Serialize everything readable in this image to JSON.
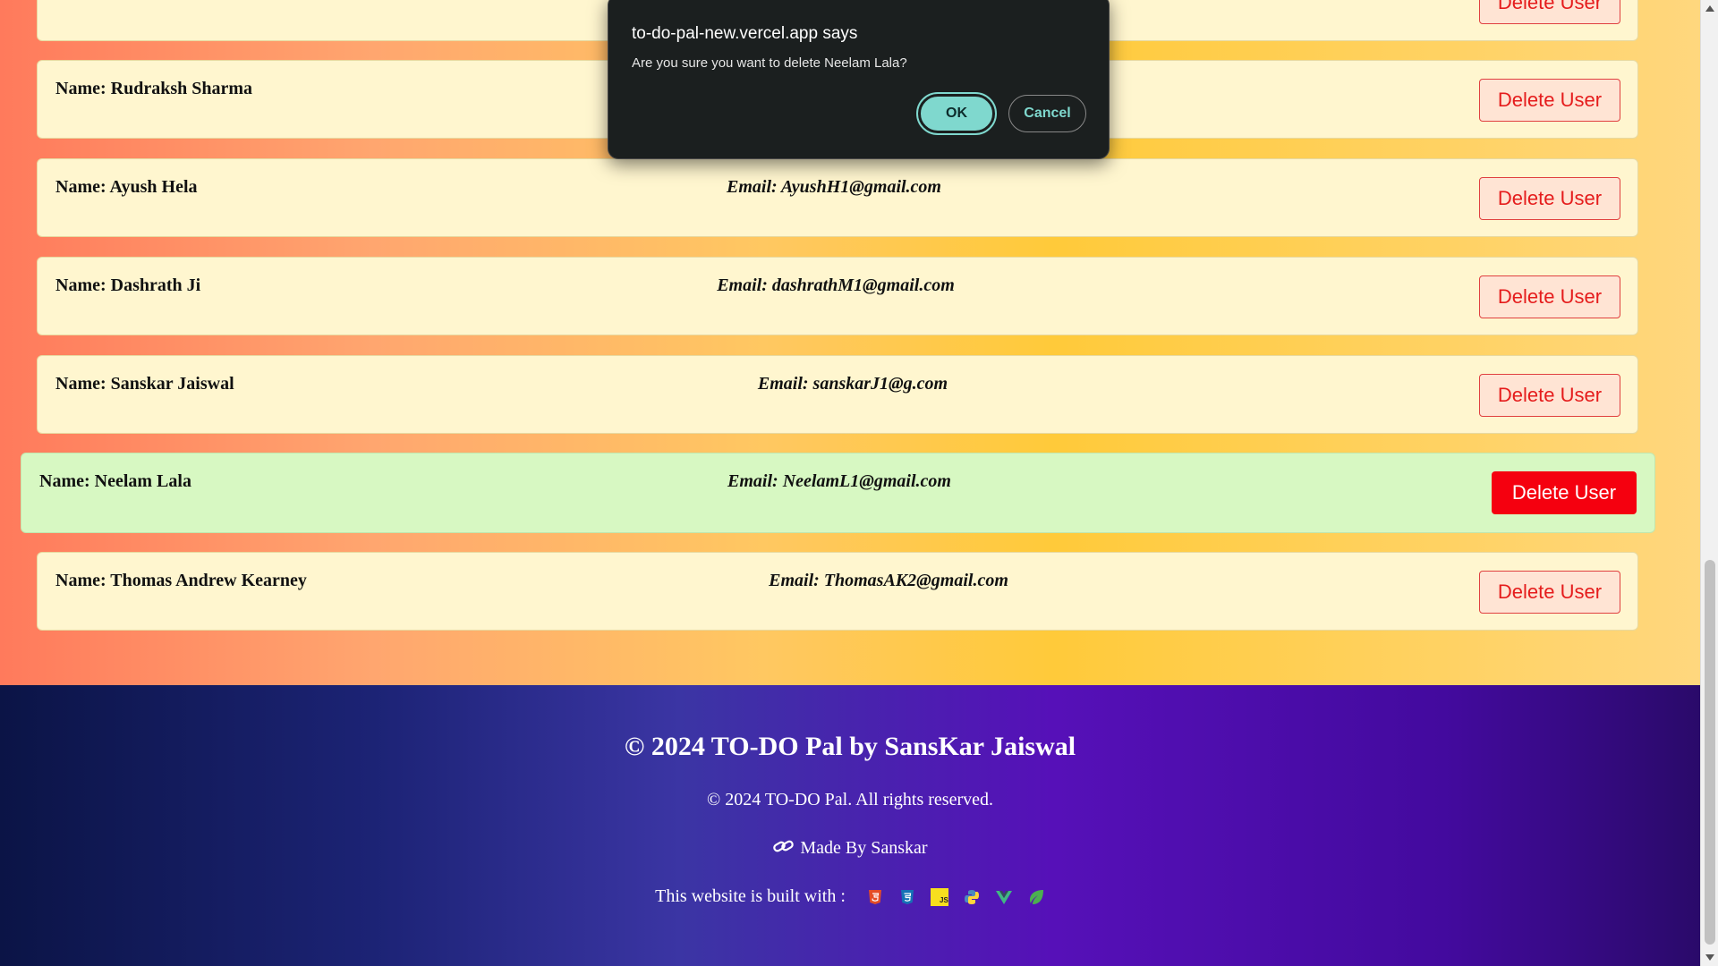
{
  "users": [
    {
      "name": "",
      "email": "",
      "button": "Delete User"
    },
    {
      "name": "Name: Rudraksh Sharma",
      "email": "",
      "button": "Delete User"
    },
    {
      "name": "Name: Ayush Hela",
      "email": "Email: AyushH1@gmail.com",
      "button": "Delete User"
    },
    {
      "name": "Name: Dashrath Ji",
      "email": "Email: dashrathM1@gmail.com",
      "button": "Delete User"
    },
    {
      "name": "Name: Sanskar Jaiswal",
      "email": "Email: sanskarJ1@g.com",
      "button": "Delete User"
    },
    {
      "name": "Name: Neelam Lala",
      "email": "Email: NeelamL1@gmail.com",
      "button": "Delete User"
    },
    {
      "name": "Name: Thomas Andrew Kearney",
      "email": "Email: ThomasAK2@gmail.com",
      "button": "Delete User"
    }
  ],
  "dialog": {
    "title": "to-do-pal-new.vercel.app says",
    "message": "Are you sure you want to delete Neelam Lala?",
    "ok_label": "OK",
    "cancel_label": "Cancel"
  },
  "footer": {
    "title": "© 2024 TO-DO Pal by SansKar Jaiswal",
    "rights": "© 2024 TO-DO Pal. All rights reserved.",
    "made_by": "Made By Sanskar",
    "built_with": "This website is built with :",
    "tech_icons": [
      "html5-icon",
      "css3-icon",
      "javascript-icon",
      "python-icon",
      "vue-icon",
      "leaf-icon"
    ]
  },
  "colors": {
    "accent_red": "#f5000f",
    "dialog_accent": "#7fd8ce",
    "card_bg": "#fff6cf",
    "active_card_bg": "#d7f8c2"
  }
}
